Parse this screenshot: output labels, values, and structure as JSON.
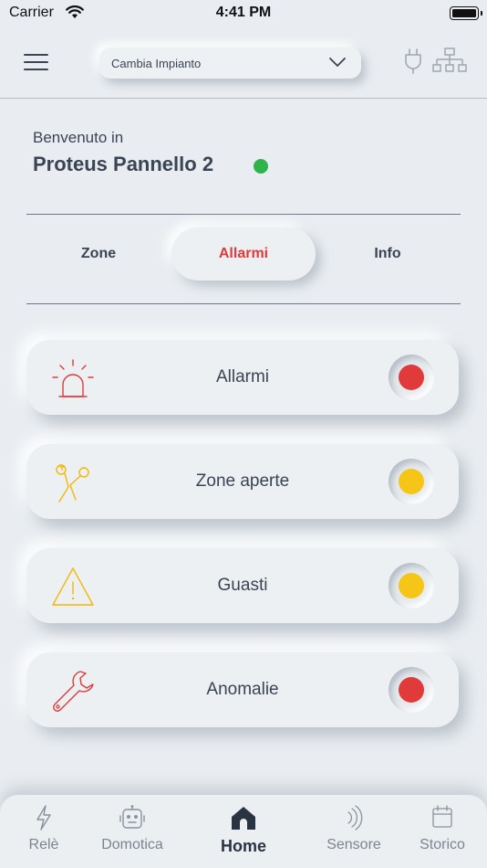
{
  "status_bar": {
    "carrier": "Carrier",
    "time": "4:41 PM"
  },
  "header": {
    "plant_select": {
      "value": "Cambia Impianto"
    }
  },
  "welcome": {
    "greeting": "Benvenuto in",
    "panel_name": "Proteus Pannello 2",
    "status_color": "#2fb34a"
  },
  "tabs": [
    {
      "label": "Zone",
      "active": false
    },
    {
      "label": "Allarmi",
      "active": true
    },
    {
      "label": "Info",
      "active": false
    }
  ],
  "cards": [
    {
      "label": "Allarmi",
      "icon": "siren-icon",
      "status_color": "#e03a3a"
    },
    {
      "label": "Zone aperte",
      "icon": "scissors-icon",
      "status_color": "#f5c518"
    },
    {
      "label": "Guasti",
      "icon": "warning-icon",
      "status_color": "#f5c518"
    },
    {
      "label": "Anomalie",
      "icon": "wrench-icon",
      "status_color": "#e03a3a"
    }
  ],
  "bottom_nav": [
    {
      "label": "Relè",
      "icon": "lightning-icon",
      "active": false
    },
    {
      "label": "Domotica",
      "icon": "robot-icon",
      "active": false
    },
    {
      "label": "Home",
      "icon": "home-icon",
      "active": true
    },
    {
      "label": "Sensore",
      "icon": "signal-icon",
      "active": false
    },
    {
      "label": "Storico",
      "icon": "calendar-icon",
      "active": false
    }
  ],
  "colors": {
    "accent_red": "#e03a3a",
    "accent_yellow": "#f5c518",
    "text_dark": "#3b4452",
    "background": "#e9edf1"
  }
}
